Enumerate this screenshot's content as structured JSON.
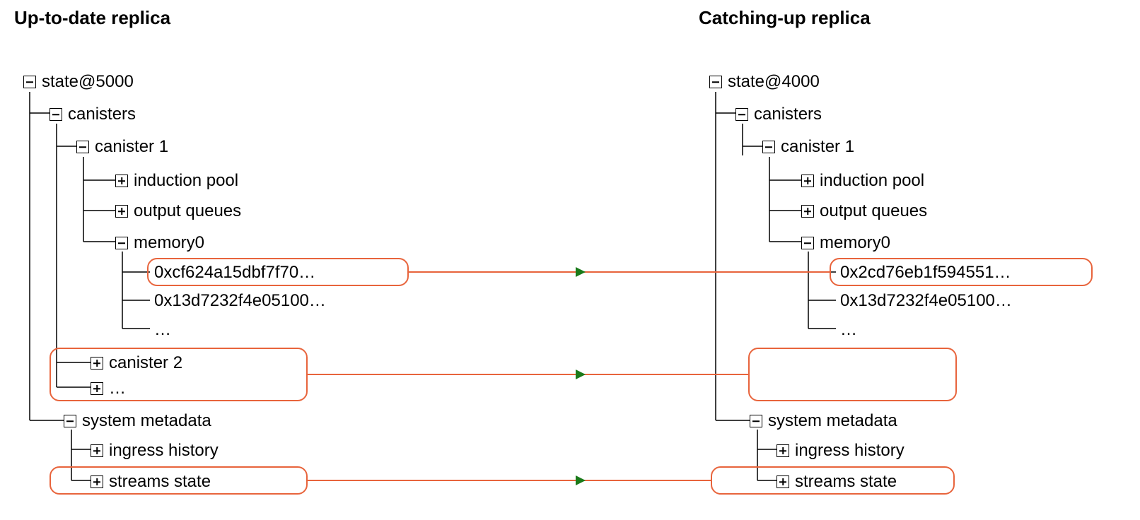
{
  "left": {
    "title": "Up-to-date replica",
    "root": "state@5000",
    "canisters": "canisters",
    "canister1": "canister 1",
    "induction_pool": "induction pool",
    "output_queues": "output queues",
    "memory0": "memory0",
    "hash1": "0xcf624a15dbf7f70…",
    "hash2": "0x13d7232f4e05100…",
    "hash_dots": "…",
    "canister2": "canister 2",
    "canister_dots": "…",
    "system_metadata": "system metadata",
    "ingress_history": "ingress history",
    "streams_state": "streams state"
  },
  "right": {
    "title": "Catching-up replica",
    "root": "state@4000",
    "canisters": "canisters",
    "canister1": "canister 1",
    "induction_pool": "induction pool",
    "output_queues": "output queues",
    "memory0": "memory0",
    "hash1": "0x2cd76eb1f594551…",
    "hash2": "0x13d7232f4e05100…",
    "hash_dots": "…",
    "system_metadata": "system metadata",
    "ingress_history": "ingress history",
    "streams_state": "streams state"
  },
  "colors": {
    "highlight": "#e8643c",
    "arrow_head": "#1a7a1a"
  }
}
